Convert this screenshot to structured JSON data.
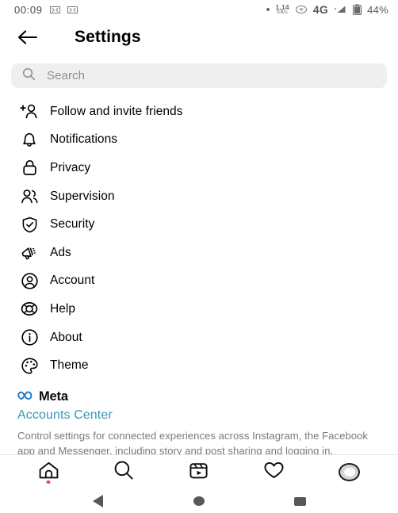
{
  "statusbar": {
    "time": "00:09",
    "left_icons": [
      "sim-card-icon",
      "sim-card-icon"
    ],
    "dot_icon": "recording-dot-icon",
    "net_speed_value": "1.14",
    "net_speed_unit": "KB/s",
    "hotspot_icon": "wifi-hotspot-icon",
    "network_type": "4G",
    "signal_icon": "signal-bars-icon",
    "battery_icon": "battery-icon",
    "battery_level": "44%"
  },
  "header": {
    "back_icon": "arrow-left-icon",
    "title": "Settings"
  },
  "search": {
    "icon": "search-icon",
    "placeholder": "Search",
    "value": ""
  },
  "menu": {
    "items": [
      {
        "label": "Follow and invite friends",
        "icon": "person-add-icon"
      },
      {
        "label": "Notifications",
        "icon": "bell-icon"
      },
      {
        "label": "Privacy",
        "icon": "lock-icon"
      },
      {
        "label": "Supervision",
        "icon": "people-icon"
      },
      {
        "label": "Security",
        "icon": "shield-check-icon"
      },
      {
        "label": "Ads",
        "icon": "megaphone-icon"
      },
      {
        "label": "Account",
        "icon": "account-circle-icon"
      },
      {
        "label": "Help",
        "icon": "life-ring-icon"
      },
      {
        "label": "About",
        "icon": "info-circle-icon"
      },
      {
        "label": "Theme",
        "icon": "palette-icon"
      }
    ]
  },
  "meta": {
    "logo_icon": "meta-infinity-icon",
    "brand": "Meta",
    "accounts_center": "Accounts Center",
    "description": "Control settings for connected experiences across Instagram, the Facebook app and Messenger, including story and post sharing and logging in."
  },
  "tabbar": {
    "items": [
      {
        "name": "home",
        "icon": "home-icon",
        "badge": true
      },
      {
        "name": "search",
        "icon": "search-icon",
        "badge": false
      },
      {
        "name": "reels",
        "icon": "reels-icon",
        "badge": false
      },
      {
        "name": "activity",
        "icon": "heart-icon",
        "badge": false
      },
      {
        "name": "profile",
        "icon": "avatar-icon",
        "badge": false
      }
    ]
  },
  "androidnav": {
    "back": "nav-back-icon",
    "home": "nav-home-icon",
    "recents": "nav-recents-icon"
  },
  "colors": {
    "accent_link": "#3697b6",
    "meta_blue": "#0e6ec4",
    "badge_red": "#ef4a62",
    "search_bg": "#efefef",
    "muted_text": "#7b7b7b"
  }
}
